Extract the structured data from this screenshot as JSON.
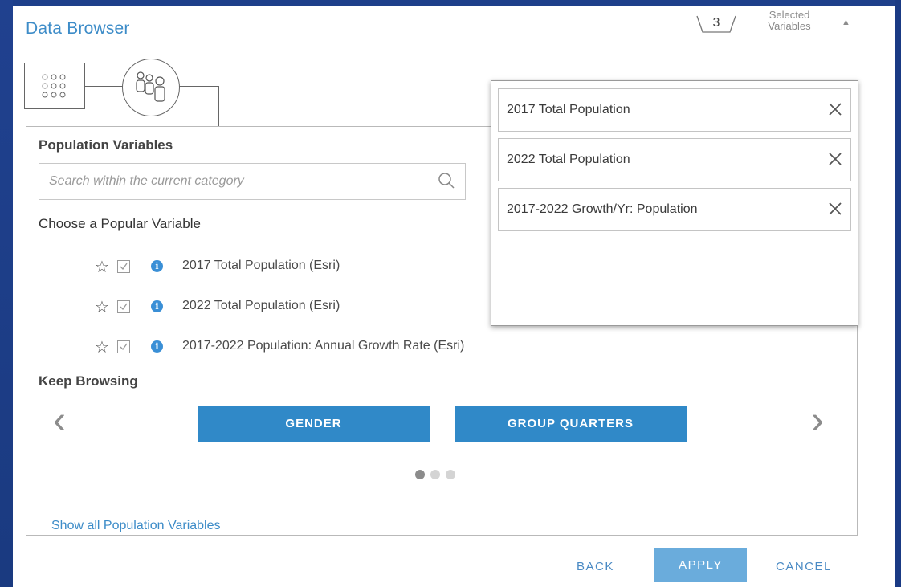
{
  "header": {
    "title": "Data Browser",
    "selected_count": "3",
    "selected_label_line1": "Selected",
    "selected_label_line2": "Variables"
  },
  "category": {
    "heading": "Population Variables",
    "search_placeholder": "Search within the current category"
  },
  "popular": {
    "heading": "Choose a Popular Variable",
    "items": [
      {
        "label": "2017 Total Population (Esri)",
        "checked": true
      },
      {
        "label": "2022 Total Population (Esri)",
        "checked": true
      },
      {
        "label": "2017-2022 Population: Annual Growth Rate (Esri)",
        "checked": true
      }
    ]
  },
  "browse": {
    "heading": "Keep Browsing",
    "buttons": [
      "GENDER",
      "GROUP QUARTERS"
    ],
    "pages": 3,
    "active_page": 1
  },
  "show_all_link": "Show all Population Variables",
  "footer": {
    "back": "BACK",
    "apply": "APPLY",
    "cancel": "CANCEL"
  },
  "selected_variables": [
    {
      "label": "2017 Total Population"
    },
    {
      "label": "2022 Total Population"
    },
    {
      "label": "2017-2022 Growth/Yr: Population"
    }
  ],
  "colors": {
    "accent": "#3d8cc8",
    "button_blue": "#3089c8",
    "apply_blue": "#6aacdc",
    "info_blue": "#3a8fd6"
  }
}
